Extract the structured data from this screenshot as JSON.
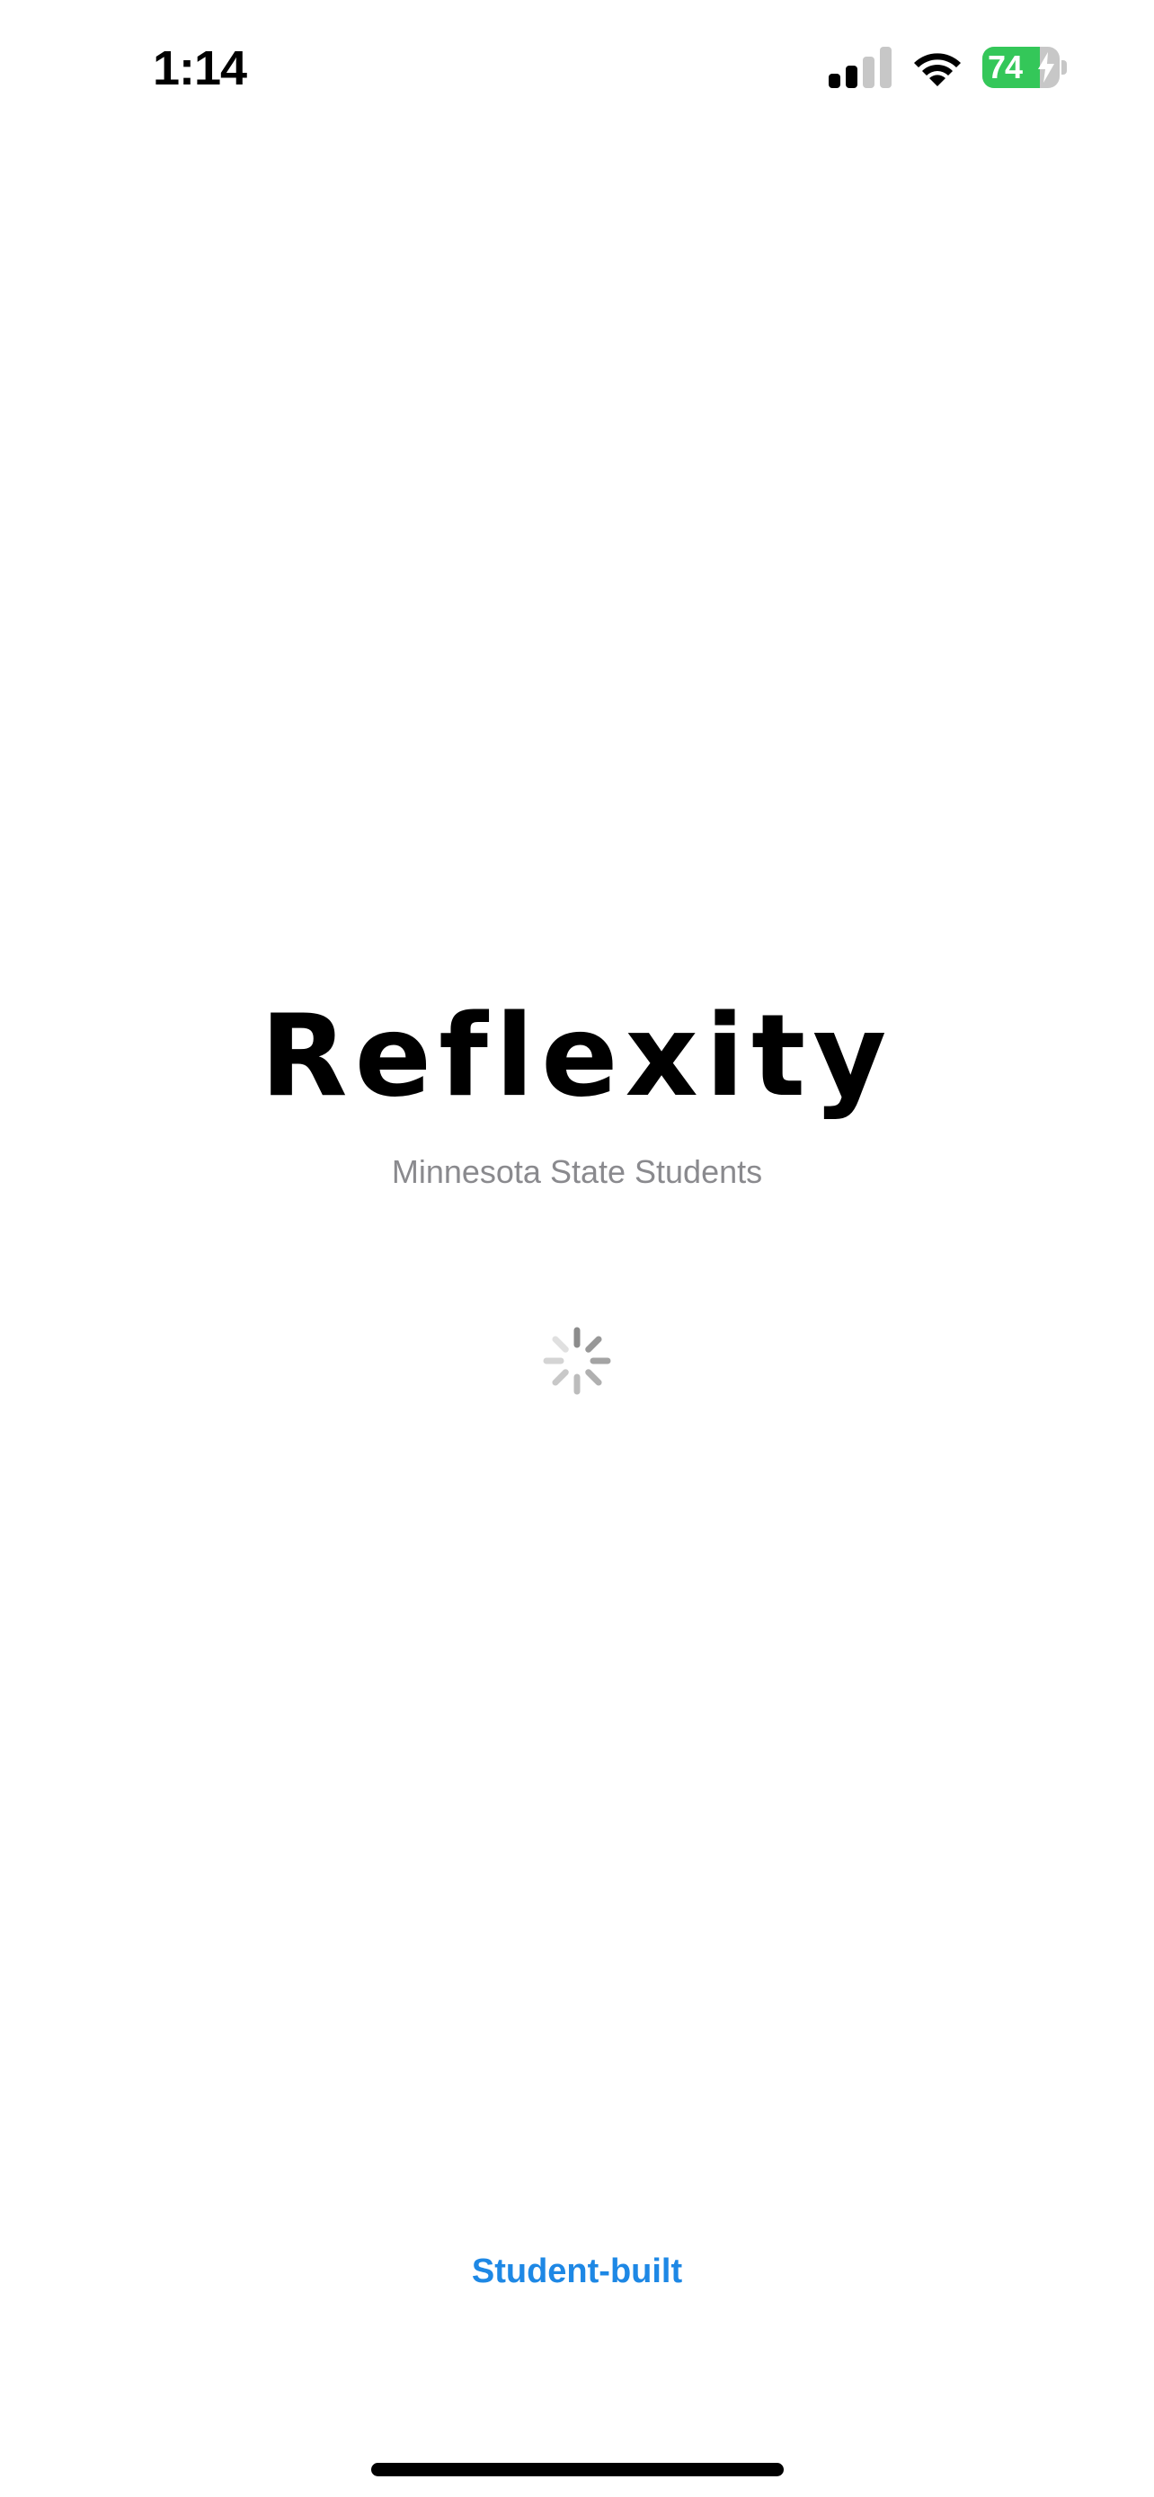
{
  "status_bar": {
    "time": "1:14",
    "battery_percent": "74",
    "battery_level": 0.74,
    "charging": true,
    "cell_signal_bars": 2,
    "icons": [
      "cell-signal-icon",
      "wifi-icon",
      "battery-icon",
      "charging-bolt-icon"
    ]
  },
  "splash": {
    "title": "Reflexity",
    "subtitle": "Minnesota State Students",
    "spinner_icon": "activity-spinner-icon"
  },
  "footer": {
    "link_label": "Student-built"
  },
  "colors": {
    "accent": "#1e88e5",
    "subtitle": "#8a8a8e",
    "battery_fill": "#34c759",
    "background": "#ffffff"
  }
}
